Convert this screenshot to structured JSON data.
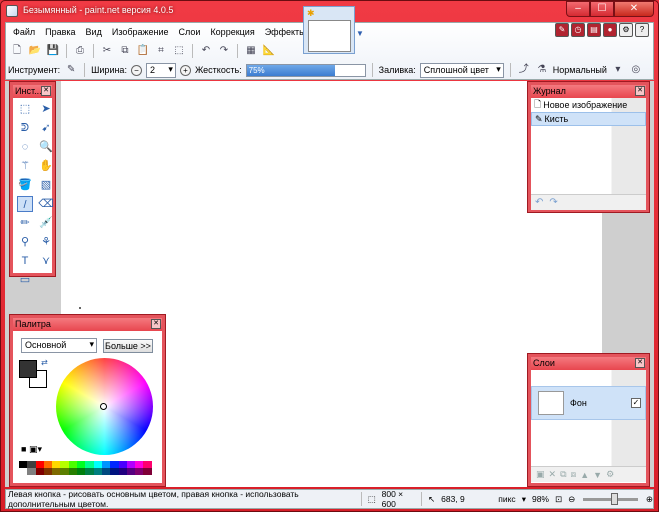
{
  "window": {
    "title": "Безымянный - paint.net версия 4.0.5",
    "min_label": "–",
    "max_label": "☐",
    "close_label": "✕"
  },
  "menu": [
    "Файл",
    "Правка",
    "Вид",
    "Изображение",
    "Слои",
    "Коррекция",
    "Эффекты"
  ],
  "toolbar": {
    "tool_label": "Инструмент:",
    "width_label": "Ширина:",
    "width_value": "2",
    "hardness_label": "Жесткость:",
    "hardness_value": "75%",
    "hardness_fraction": 0.75,
    "fill_label": "Заливка:",
    "fill_value": "Сплошной цвет",
    "blend_value": "Нормальный"
  },
  "tools_panel": {
    "title": "Инст..."
  },
  "history_panel": {
    "title": "Журнал",
    "items": [
      "Новое изображение",
      "Кисть"
    ]
  },
  "palette_panel": {
    "title": "Палитра",
    "mode_value": "Основной",
    "more_button": "Больше >>",
    "primary_color": "#333333",
    "secondary_color": "#ffffff"
  },
  "layers_panel": {
    "title": "Слои",
    "layer_name": "Фон"
  },
  "status": {
    "hint": "Левая кнопка - рисовать основным цветом, правая кнопка - использовать дополнительным цветом.",
    "image_size": "800 × 600",
    "cursor_pos": "683, 9",
    "units": "пикс",
    "zoom": "98%"
  }
}
